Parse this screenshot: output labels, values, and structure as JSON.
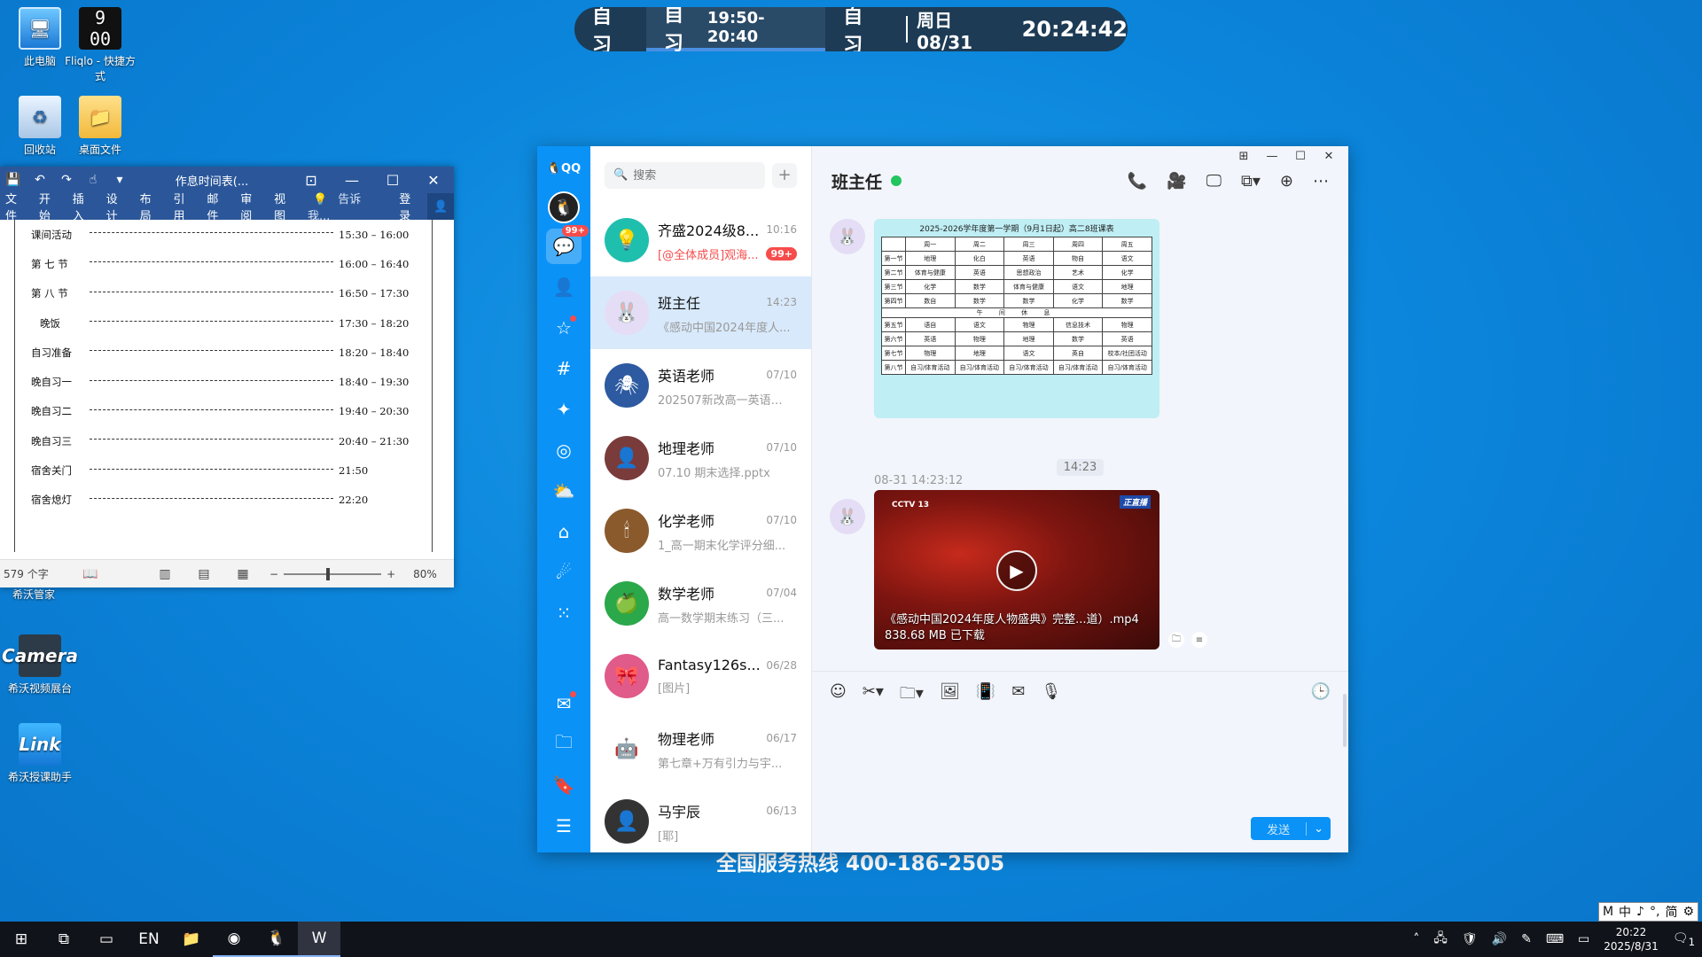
{
  "desktop": {
    "icons": [
      {
        "label": "此电脑",
        "icon": "computer-icon"
      },
      {
        "label": "Fliqlo - 快捷方式",
        "icon": "clock-icon",
        "glyph": "9 00"
      },
      {
        "label": "回收站",
        "icon": "recycle-bin-icon"
      },
      {
        "label": "桌面文件",
        "icon": "folder-icon"
      },
      {
        "label": "希沃视频展台",
        "icon": "camera-icon",
        "glyph": "Camera"
      },
      {
        "label": "希沃授课助手",
        "icon": "link-icon",
        "glyph": "Link"
      }
    ],
    "under_word_label": "希沃管家",
    "ghost_text": "全国服务热线 400-186-2505"
  },
  "schedule_bar": {
    "prev": "自习",
    "current_label": "自习",
    "current_time": "19:50-20:40",
    "next": "自习",
    "date": "周日 08/31",
    "clock": "20:24:42"
  },
  "word": {
    "title": "作息时间表(...",
    "tabs": [
      "文件",
      "开始",
      "插入",
      "设计",
      "布局",
      "引用",
      "邮件",
      "审阅",
      "视图"
    ],
    "tell_me": "告诉我...",
    "login": "登录",
    "rows": [
      {
        "label": "课间活动",
        "time": "15:30 – 16:00"
      },
      {
        "label": "第 七 节",
        "time": "16:00 – 16:40"
      },
      {
        "label": "第 八 节",
        "time": "16:50 – 17:30"
      },
      {
        "label": "晚饭",
        "time": "17:30 – 18:20"
      },
      {
        "label": "自习准备",
        "time": "18:20 – 18:40"
      },
      {
        "label": "晚自习一",
        "time": "18:40 – 19:30"
      },
      {
        "label": "晚自习二",
        "time": "19:40 – 20:30"
      },
      {
        "label": "晚自习三",
        "time": "20:40 – 21:30"
      },
      {
        "label": "宿舍关门",
        "time": "21:50"
      },
      {
        "label": "宿舍熄灯",
        "time": "22:20"
      }
    ],
    "status_count": "579 个字",
    "zoom": "80%"
  },
  "qq": {
    "logo": "QQ",
    "rail_badge": "99+",
    "search_placeholder": "搜索",
    "conversations": [
      {
        "name": "齐盛2024级8...",
        "time": "10:16",
        "msg": "[@全体成员]观海...",
        "badge": "99+",
        "mention": true,
        "avatar_color": "#1fbfae",
        "avatar_glyph": "💡"
      },
      {
        "name": "班主任",
        "time": "14:23",
        "msg": "《感动中国2024年度人...",
        "badge": "",
        "mention": false,
        "avatar_color": "#e4ddf5",
        "avatar_glyph": "🐰"
      },
      {
        "name": "英语老师",
        "time": "07/10",
        "msg": "202507新改高一英语参...",
        "badge": "",
        "mention": false,
        "avatar_color": "#2d5aa0",
        "avatar_glyph": "🕷"
      },
      {
        "name": "地理老师",
        "time": "07/10",
        "msg": "07.10 期末选择.pptx",
        "badge": "",
        "mention": false,
        "avatar_color": "#7a3b3b",
        "avatar_glyph": "👤"
      },
      {
        "name": "化学老师",
        "time": "07/10",
        "msg": "1_高一期末化学评分细...",
        "badge": "",
        "mention": false,
        "avatar_color": "#8a5a2c",
        "avatar_glyph": "🕯"
      },
      {
        "name": "数学老师",
        "time": "07/04",
        "msg": "高一数学期末练习（三...",
        "badge": "",
        "mention": false,
        "avatar_color": "#2aa84a",
        "avatar_glyph": "🍏"
      },
      {
        "name": "Fantasy126s...",
        "time": "06/28",
        "msg": "[图片]",
        "badge": "",
        "mention": false,
        "avatar_color": "#e05a8a",
        "avatar_glyph": "🎀"
      },
      {
        "name": "物理老师",
        "time": "06/17",
        "msg": "第七章+万有引力与宇...",
        "badge": "",
        "mention": false,
        "avatar_color": "#ffffff",
        "avatar_glyph": "🤖"
      },
      {
        "name": "马宇辰",
        "time": "06/13",
        "msg": "[耶]",
        "badge": "",
        "mention": false,
        "avatar_color": "#333333",
        "avatar_glyph": "👤"
      }
    ],
    "chat": {
      "title": "班主任",
      "timetable_title": "2025-2026学年度第一学期（9月1日起）高二8班课表",
      "timetable_head": [
        "",
        "周一",
        "周二",
        "周三",
        "周四",
        "周五"
      ],
      "timetable_rows": [
        [
          "第一节",
          "地理",
          "化白",
          "英语",
          "物自",
          "语文"
        ],
        [
          "第二节",
          "体育与健康",
          "英语",
          "思想政治",
          "艺术",
          "化学"
        ],
        [
          "第三节",
          "化学",
          "数学",
          "体育与健康",
          "语文",
          "地理"
        ],
        [
          "第四节",
          "数自",
          "数学",
          "数学",
          "化学",
          "数学"
        ],
        [
          "第五节",
          "语自",
          "语文",
          "物理",
          "信息技术",
          "物理"
        ],
        [
          "第六节",
          "英语",
          "物理",
          "地理",
          "数学",
          "英语"
        ],
        [
          "第七节",
          "物理",
          "地理",
          "语文",
          "英自",
          "校本/社团活动"
        ],
        [
          "第八节",
          "自习/体育活动",
          "自习/体育活动",
          "自习/体育活动",
          "自习/体育活动",
          "自习/体育活动"
        ]
      ],
      "rest_label": "午 间 休 息",
      "center_time": "14:23",
      "sender_time": "08-31 14:23:12",
      "video_logo": "CCTV 13",
      "video_tag": "正直播",
      "video_name": "《感动中国2024年度人物盛典》完整...道）.mp4",
      "video_size": "838.68 MB 已下载",
      "send_label": "发送"
    }
  },
  "ime": [
    "M",
    "中",
    "♪",
    "°,",
    "简",
    "⚙"
  ],
  "taskbar": {
    "clock_time": "20:22",
    "clock_date": "2025/8/31",
    "notify_count": "1"
  }
}
